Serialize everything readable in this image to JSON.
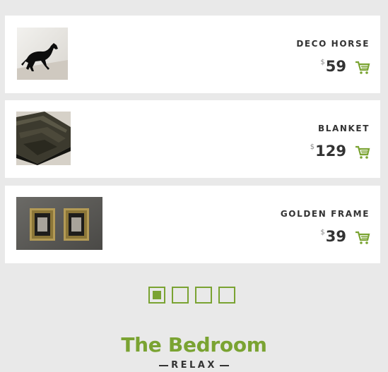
{
  "products": [
    {
      "name": "DECO HORSE",
      "currency": "$",
      "price": "59",
      "cart_icon": "cart-icon",
      "image_icon": "horse-image"
    },
    {
      "name": "BLANKET",
      "currency": "$",
      "price": "129",
      "cart_icon": "cart-icon",
      "image_icon": "blanket-image"
    },
    {
      "name": "GOLDEN FRAME",
      "currency": "$",
      "price": "39",
      "cart_icon": "cart-icon",
      "image_icon": "frames-image"
    }
  ],
  "pagination": {
    "count": 4,
    "active_index": 0
  },
  "section": {
    "title": "The Bedroom",
    "subtitle": "RELAX"
  },
  "colors": {
    "accent": "#7aa332",
    "text": "#333333",
    "background": "#e9e9e9"
  }
}
